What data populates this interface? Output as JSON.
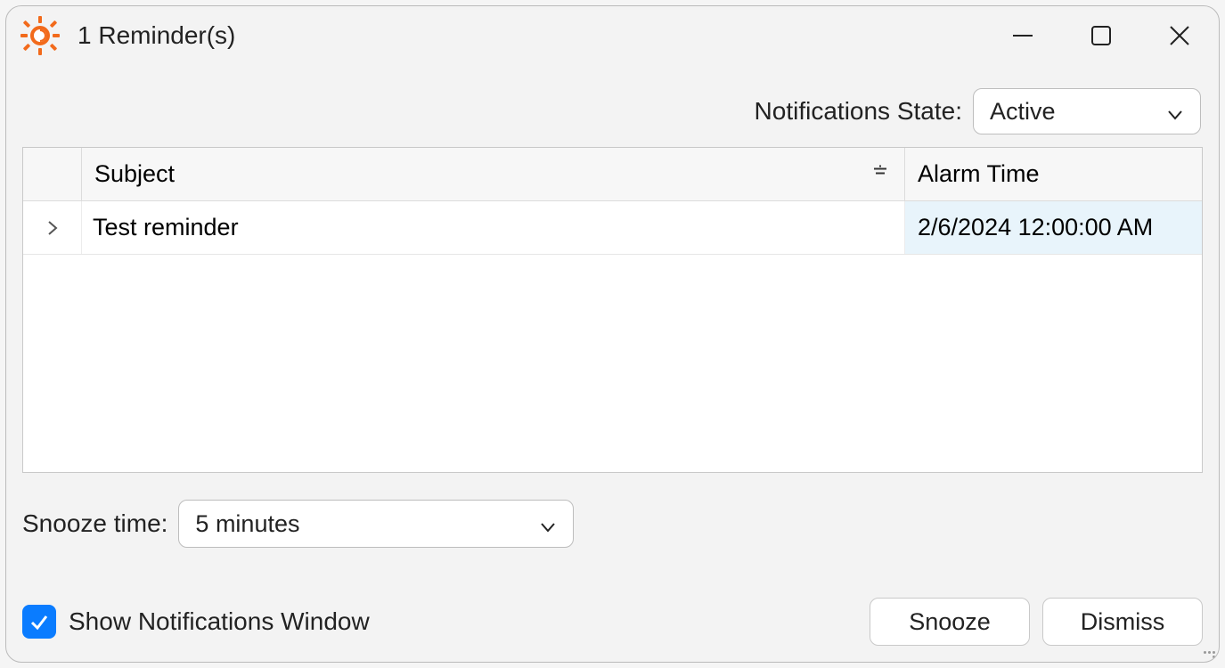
{
  "window": {
    "title": "1 Reminder(s)"
  },
  "toolbar": {
    "state_label": "Notifications State:",
    "state_value": "Active"
  },
  "grid": {
    "headers": {
      "subject": "Subject",
      "alarm": "Alarm Time"
    },
    "rows": [
      {
        "subject": "Test reminder",
        "alarm": "2/6/2024 12:00:00 AM"
      }
    ]
  },
  "snooze": {
    "label": "Snooze time:",
    "value": "5 minutes"
  },
  "footer": {
    "show_notifications": "Show Notifications Window",
    "snooze_btn": "Snooze",
    "dismiss_btn": "Dismiss",
    "checked": true
  }
}
